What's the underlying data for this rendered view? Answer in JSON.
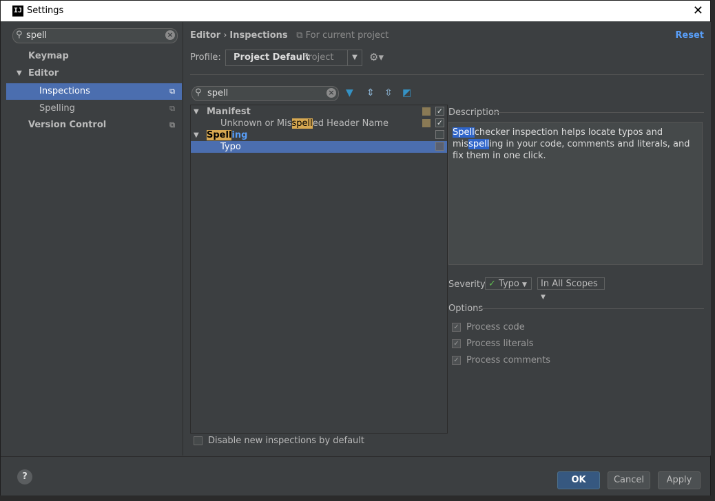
{
  "window": {
    "title": "Settings",
    "app_icon": "IJ"
  },
  "sidebar": {
    "search_value": "spell",
    "items": [
      {
        "label": "Keymap"
      },
      {
        "label": "Editor"
      },
      {
        "label": "Inspections"
      },
      {
        "label": "Spelling"
      },
      {
        "label": "Version Control"
      }
    ]
  },
  "header": {
    "crumb_editor": "Editor",
    "crumb_sep": "›",
    "crumb_inspections": "Inspections",
    "scope": "For current project",
    "reset": "Reset"
  },
  "profile": {
    "label": "Profile:",
    "name": "Project Default",
    "type": "Project"
  },
  "inspections": {
    "search_value": "spell",
    "tree": {
      "manifest": "Manifest",
      "unknown_pre": "Unknown or Mis",
      "unknown_hl": "spell",
      "unknown_post": "ed Header Name",
      "spelling_hl": "Spell",
      "spelling_post": "ing",
      "typo": "Typo"
    },
    "disable_new": "Disable new inspections by default"
  },
  "description": {
    "label": "Description",
    "m1": "Spell",
    "t1": "checker inspection helps locate typos and mis",
    "m2": "spell",
    "t2": "ing in your code, comments and literals, and fix them in one click."
  },
  "severity": {
    "label": "Severity:",
    "value": "Typo",
    "scope": "In All Scopes"
  },
  "options": {
    "label": "Options",
    "items": [
      "Process code",
      "Process literals",
      "Process comments"
    ]
  },
  "footer": {
    "help": "?",
    "ok": "OK",
    "cancel": "Cancel",
    "apply": "Apply"
  }
}
